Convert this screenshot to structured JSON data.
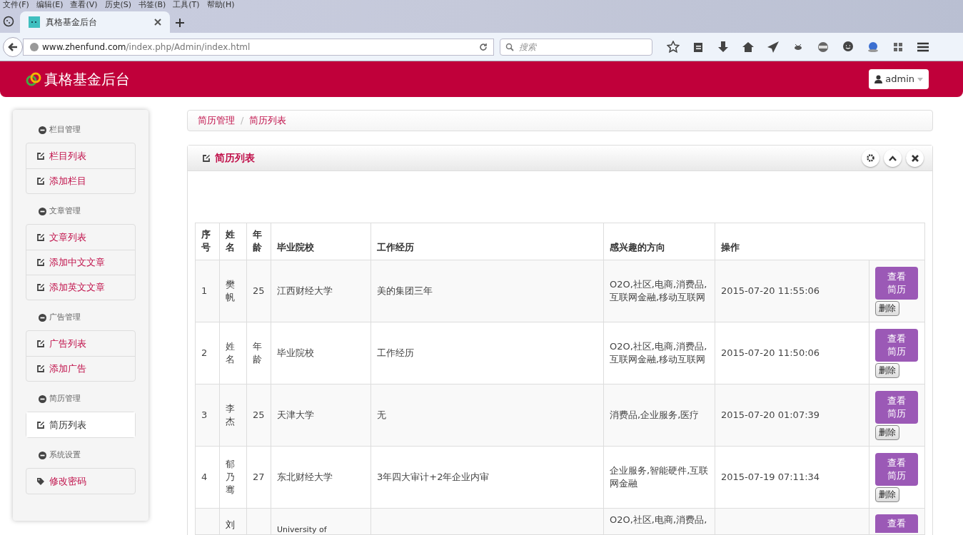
{
  "browser": {
    "menu": [
      "文件(F)",
      "编辑(E)",
      "查看(V)",
      "历史(S)",
      "书签(B)",
      "工具(T)",
      "帮助(H)"
    ],
    "tabs": [
      {
        "title": "真格基金后台",
        "selected": true
      }
    ],
    "url": {
      "host": "www.zhenfund.com",
      "path": "/index.php/Admin/index.html"
    },
    "search": {
      "placeholder": "搜索"
    }
  },
  "header": {
    "title": "真格基金后台",
    "user": "admin"
  },
  "sidebar": [
    {
      "heading": "栏目管理",
      "items": [
        {
          "label": "栏目列表",
          "selected": false,
          "kind": "edit"
        },
        {
          "label": "添加栏目",
          "selected": false,
          "kind": "edit"
        }
      ]
    },
    {
      "heading": "文章管理",
      "items": [
        {
          "label": "文章列表",
          "selected": false,
          "kind": "edit"
        },
        {
          "label": "添加中文文章",
          "selected": false,
          "kind": "edit"
        },
        {
          "label": "添加英文文章",
          "selected": false,
          "kind": "edit"
        }
      ]
    },
    {
      "heading": "广告管理",
      "items": [
        {
          "label": "广告列表",
          "selected": false,
          "kind": "edit"
        },
        {
          "label": "添加广告",
          "selected": false,
          "kind": "edit"
        }
      ]
    },
    {
      "heading": "简历管理",
      "items": [
        {
          "label": "简历列表",
          "selected": true,
          "kind": "edit"
        }
      ]
    },
    {
      "heading": "系统设置",
      "items": [
        {
          "label": "修改密码",
          "selected": false,
          "kind": "tag"
        }
      ]
    }
  ],
  "breadcrumb": [
    "简历管理",
    "简历列表"
  ],
  "breadcrumb_separator": "/",
  "panel": {
    "title": "简历列表"
  },
  "table": {
    "columns": [
      "序号",
      "姓名",
      "年龄",
      "毕业院校",
      "工作经历",
      "感兴趣的方向",
      "操作"
    ],
    "rows": [
      {
        "cells": [
          "1",
          "樊帆",
          "25",
          "江西财经大学",
          "美的集团三年",
          "O2O,社区,电商,消费品,互联网金融,移动互联网",
          "2015-07-20 11:55:06"
        ],
        "view": "查看简历",
        "delete": "删除"
      },
      {
        "cells": [
          "2",
          "姓名",
          "年龄",
          "毕业院校",
          "工作经历",
          "O2O,社区,电商,消费品,互联网金融,移动互联网",
          "2015-07-20 11:50:06"
        ],
        "view": "查看简历",
        "delete": "删除"
      },
      {
        "cells": [
          "3",
          "李杰",
          "25",
          "天津大学",
          "无",
          "消费品,企业服务,医疗",
          "2015-07-20 01:07:39"
        ],
        "view": "查看简历",
        "delete": "删除"
      },
      {
        "cells": [
          "4",
          "郁乃骞",
          "27",
          "东北财经大学",
          "3年四大审计+2年企业内审",
          "企业服务,智能硬件,互联网金融",
          "2015-07-19 07:11:34"
        ],
        "view": "查看简历",
        "delete": "删除"
      }
    ],
    "partial_row": {
      "name": "刘",
      "school": "University of",
      "interests": "O2O,社区,电商,消费品,",
      "view": "查看"
    }
  }
}
